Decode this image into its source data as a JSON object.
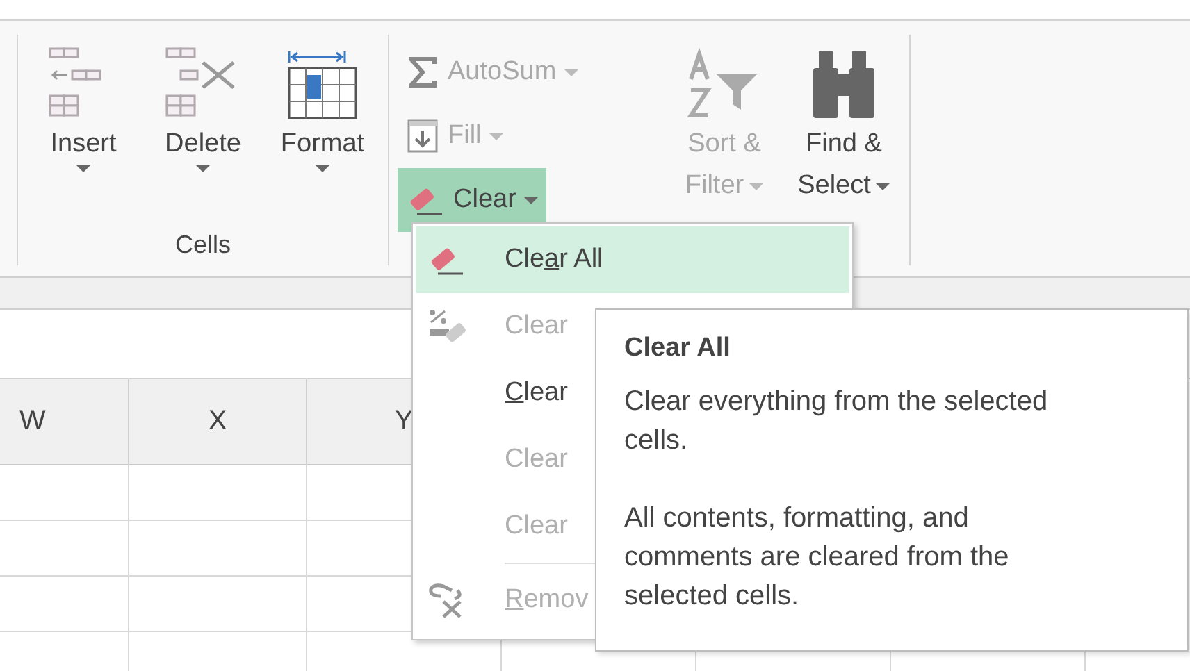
{
  "ribbon": {
    "groups": [
      {
        "label": "Cells",
        "large_buttons": [
          {
            "kind": "insert",
            "lines": [
              "Insert"
            ],
            "disabled": false
          },
          {
            "kind": "delete",
            "lines": [
              "Delete"
            ],
            "disabled": false
          },
          {
            "kind": "format",
            "lines": [
              "Format"
            ],
            "disabled": false
          }
        ]
      },
      {
        "small_buttons": [
          {
            "kind": "sum",
            "label": "AutoSum",
            "disabled": true,
            "selected": false
          },
          {
            "kind": "fill",
            "label": "Fill",
            "disabled": true,
            "selected": false
          },
          {
            "kind": "eraser",
            "label": "Clear",
            "disabled": false,
            "selected": true
          }
        ],
        "large_buttons": [
          {
            "kind": "sort",
            "lines": [
              "Sort &",
              "Filter"
            ],
            "disabled": true
          },
          {
            "kind": "find",
            "lines": [
              "Find &",
              "Select"
            ],
            "disabled": false
          }
        ]
      }
    ]
  },
  "sheet": {
    "columns": [
      "W",
      "X",
      "Y"
    ]
  },
  "menu": {
    "items": [
      {
        "kind": "eraser",
        "pre": "Cle",
        "key": "a",
        "post": "r All",
        "selected": true,
        "disabled": false
      },
      {
        "kind": "percent",
        "pre": "Clear",
        "selected": false,
        "disabled": true
      },
      {
        "kind": "none",
        "key": "C",
        "post": "lear",
        "selected": false,
        "disabled": false
      },
      {
        "kind": "none",
        "pre": "Clear",
        "selected": false,
        "disabled": true
      },
      {
        "kind": "none",
        "pre": "Clear",
        "selected": false,
        "disabled": true
      },
      {
        "kind": "separator"
      },
      {
        "kind": "unlink",
        "key": "R",
        "post": "emov",
        "selected": false,
        "disabled": true
      }
    ]
  },
  "tooltip": {
    "title": "Clear All",
    "paragraphs": [
      "Clear everything from the selected cells.",
      "All contents, formatting, and comments are cleared from the selected cells."
    ]
  }
}
